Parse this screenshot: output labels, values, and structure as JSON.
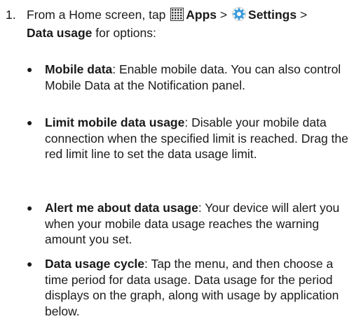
{
  "step": {
    "number": "1.",
    "intro_pre": "From a Home screen, tap",
    "apps_label": "Apps",
    "separator1": ">",
    "settings_label": "Settings",
    "separator2": ">",
    "data_usage_label": "Data usage",
    "intro_post": "for options:",
    "apps_icon": "apps-grid-icon",
    "settings_icon": "settings-gear-icon"
  },
  "bullets": [
    {
      "term": "Mobile data",
      "text": ": Enable mobile data. You can also control Mobile Data at the Notification panel."
    },
    {
      "term": "Limit mobile data usage",
      "text": ": Disable your mobile data connection when the specified limit is reached. Drag the red limit line to set the data usage limit."
    },
    {
      "term": "Alert me about data usage",
      "text": ": Your device will alert you when your mobile data usage reaches the warning amount you set."
    },
    {
      "term": "Data usage cycle",
      "text": ": Tap the menu, and then choose a time period for data usage. Data usage for the period displays on the graph, along with usage by application below."
    }
  ],
  "colors": {
    "text": "#1a1a1a",
    "settings_icon_blue": "#3a9ad9"
  }
}
